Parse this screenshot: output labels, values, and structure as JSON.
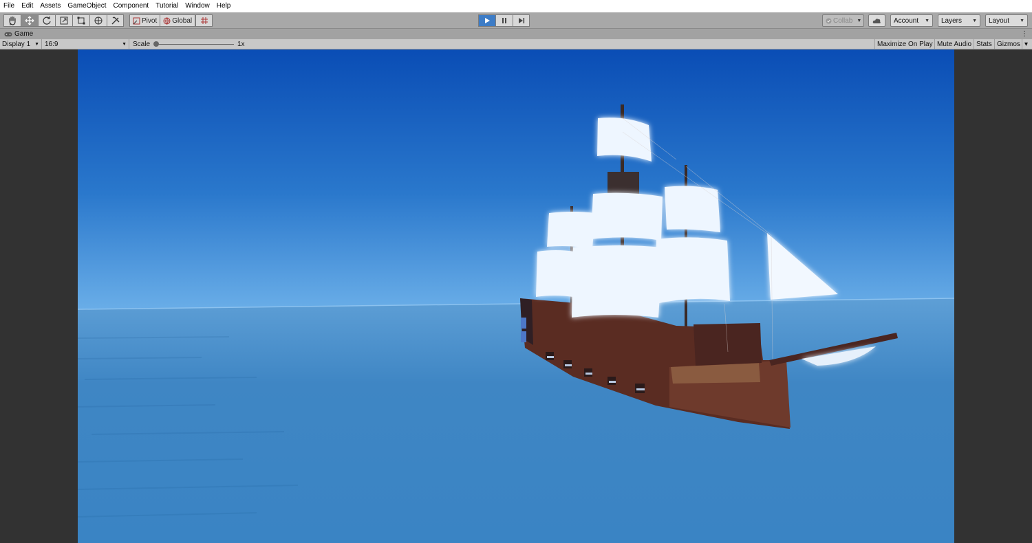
{
  "menu": {
    "items": [
      "File",
      "Edit",
      "Assets",
      "GameObject",
      "Component",
      "Tutorial",
      "Window",
      "Help"
    ]
  },
  "toolbar": {
    "tools": [
      {
        "name": "hand-tool",
        "icon": "hand-icon"
      },
      {
        "name": "move-tool",
        "icon": "move-icon"
      },
      {
        "name": "rotate-tool",
        "icon": "rotate-icon"
      },
      {
        "name": "scale-tool",
        "icon": "scale-icon"
      },
      {
        "name": "rect-tool",
        "icon": "rect-icon"
      },
      {
        "name": "transform-tool",
        "icon": "transform-icon"
      },
      {
        "name": "custom-tool",
        "icon": "tools-icon"
      }
    ],
    "pivot_label": "Pivot",
    "global_label": "Global",
    "collab_label": "Collab",
    "account_label": "Account",
    "layers_label": "Layers",
    "layout_label": "Layout"
  },
  "game_tab": {
    "title": "Game"
  },
  "game_toolbar": {
    "display": "Display 1",
    "aspect": "16:9",
    "scale_label": "Scale",
    "scale_value": "1x",
    "maximize_label": "Maximize On Play",
    "mute_label": "Mute Audio",
    "stats_label": "Stats",
    "gizmos_label": "Gizmos"
  },
  "colors": {
    "play_active": "#3d7cc6",
    "sky_top": "#0a4fb7",
    "sky_horizon": "#5fa4e6",
    "sea": "#3f86c4",
    "hull": "#5a2c22",
    "sail": "#eef6ff"
  }
}
